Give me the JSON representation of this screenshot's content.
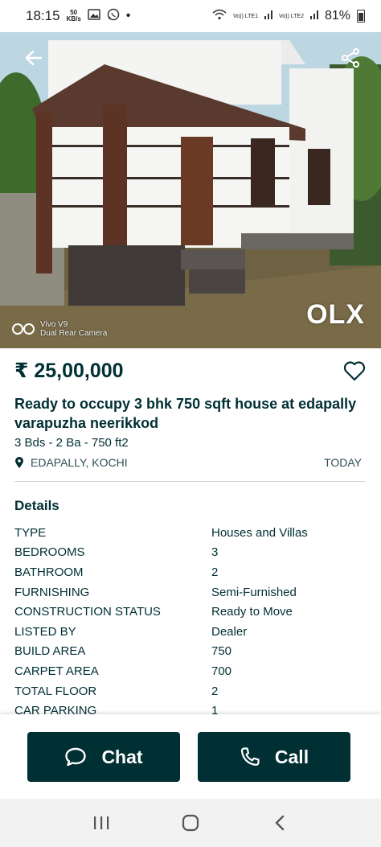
{
  "status_bar": {
    "time": "18:15",
    "net_speed_value": "50",
    "net_speed_unit": "KB/s",
    "dot": "•",
    "sim1_label": "Vo)) LTE1",
    "sim2_label": "Vo)) LTE2",
    "battery_pct": "81%"
  },
  "hero": {
    "camera_line1": "Vivo V9",
    "camera_line2": "Dual Rear Camera",
    "logo_text": "OLX"
  },
  "listing": {
    "price": "₹ 25,00,000",
    "title": "Ready to occupy 3 bhk 750 sqft house at edapally varapuzha neerikkod",
    "specs": "3 Bds - 2 Ba - 750 ft2",
    "location": "EDAPALLY, KOCHI",
    "posted": "TODAY"
  },
  "details": {
    "heading": "Details",
    "rows": [
      {
        "key": "TYPE",
        "value": "Houses and Villas"
      },
      {
        "key": "BEDROOMS",
        "value": "3"
      },
      {
        "key": "BATHROOM",
        "value": "2"
      },
      {
        "key": "FURNISHING",
        "value": "Semi-Furnished"
      },
      {
        "key": "CONSTRUCTION STATUS",
        "value": "Ready to Move"
      },
      {
        "key": "LISTED BY",
        "value": "Dealer"
      },
      {
        "key": "BUILD AREA",
        "value": "750"
      },
      {
        "key": "CARPET AREA",
        "value": "700"
      },
      {
        "key": "TOTAL FLOOR",
        "value": "2"
      },
      {
        "key": "CAR PARKING",
        "value": "1"
      }
    ]
  },
  "actions": {
    "chat_label": "Chat",
    "call_label": "Call"
  },
  "colors": {
    "primary": "#002f34"
  }
}
